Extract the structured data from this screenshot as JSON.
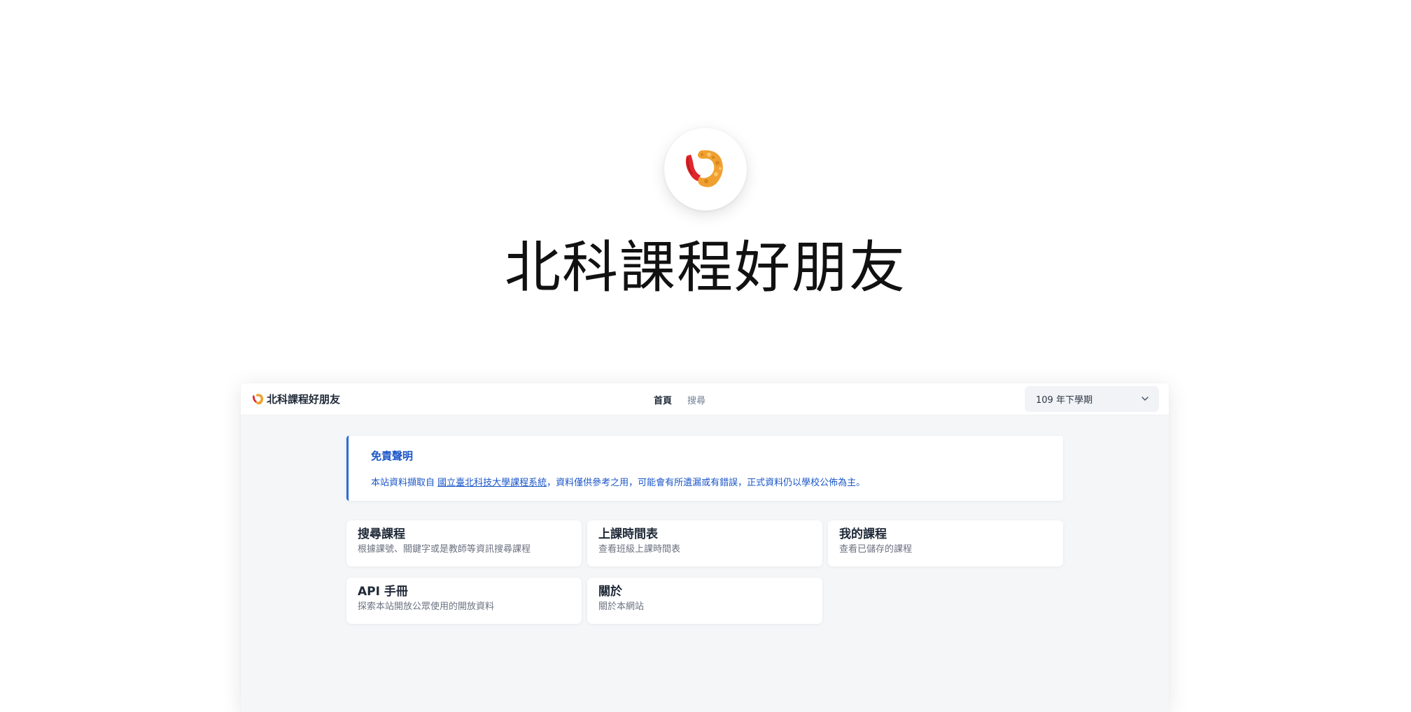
{
  "hero": {
    "logo_icon": "shrimp-tempura-icon",
    "title": "北科課程好朋友"
  },
  "navbar": {
    "brand_icon": "shrimp-tempura-icon",
    "brand_text": "北科課程好朋友",
    "links": [
      {
        "label": "首頁",
        "active": true
      },
      {
        "label": "搜尋",
        "active": false
      }
    ],
    "semester_select": {
      "value": "109 年下學期",
      "icon": "chevron-down-icon"
    }
  },
  "notice": {
    "title": "免責聲明",
    "text_before": "本站資料擷取自 ",
    "link_text": "國立臺北科技大學課程系統",
    "text_after": "，資料僅供參考之用，可能會有所遺漏或有錯誤，正式資料仍以學校公佈為主。"
  },
  "cards": [
    {
      "title": "搜尋課程",
      "desc": "根據課號、關鍵字或是教師等資訊搜尋課程"
    },
    {
      "title": "上課時間表",
      "desc": "查看班級上課時間表"
    },
    {
      "title": "我的課程",
      "desc": "查看已儲存的課程"
    },
    {
      "title": "API 手冊",
      "desc": "探索本站開放公眾使用的開放資料"
    },
    {
      "title": "關於",
      "desc": "關於本網站"
    }
  ],
  "colors": {
    "accent": "#1a56c8",
    "window_bg": "#f4f6f8",
    "text_dark": "#1f2937"
  }
}
